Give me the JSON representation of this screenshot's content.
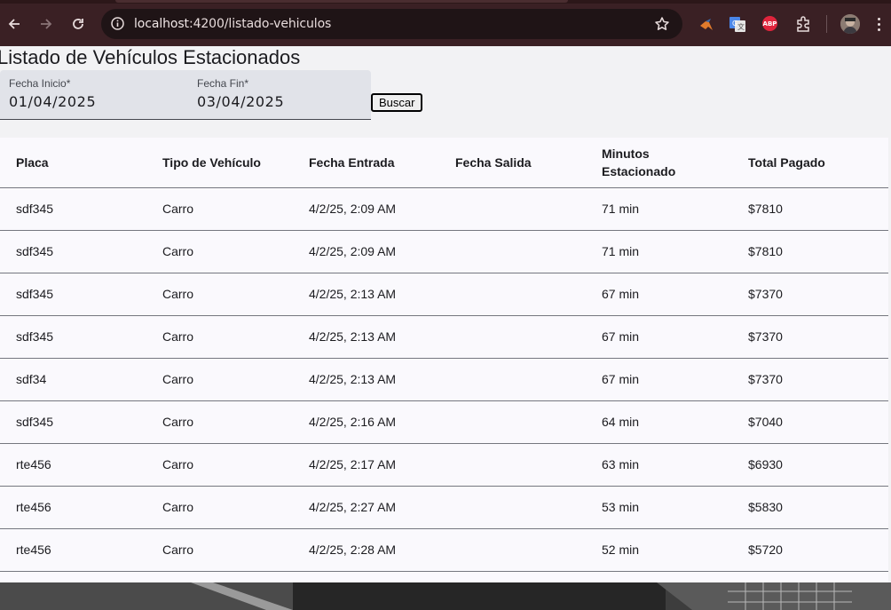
{
  "browser": {
    "url_host": "localhost",
    "url_rest": ":4200/listado-vehiculos",
    "ext_abp_label": "ABP"
  },
  "page": {
    "title": "Listado de Vehículos Estacionados",
    "fecha_inicio": {
      "label": "Fecha Inicio*",
      "value": "01/04/2025"
    },
    "fecha_fin": {
      "label": "Fecha Fin*",
      "value": "03/04/2025"
    },
    "buscar_label": "Buscar"
  },
  "table": {
    "headers": [
      "Placa",
      "Tipo de Vehículo",
      "Fecha Entrada",
      "Fecha Salida",
      "Minutos Estacionado",
      "Total Pagado"
    ],
    "rows": [
      [
        "sdf345",
        "Carro",
        "4/2/25, 2:09 AM",
        "",
        "71 min",
        "$7810"
      ],
      [
        "sdf345",
        "Carro",
        "4/2/25, 2:09 AM",
        "",
        "71 min",
        "$7810"
      ],
      [
        "sdf345",
        "Carro",
        "4/2/25, 2:13 AM",
        "",
        "67 min",
        "$7370"
      ],
      [
        "sdf345",
        "Carro",
        "4/2/25, 2:13 AM",
        "",
        "67 min",
        "$7370"
      ],
      [
        "sdf34",
        "Carro",
        "4/2/25, 2:13 AM",
        "",
        "67 min",
        "$7370"
      ],
      [
        "sdf345",
        "Carro",
        "4/2/25, 2:16 AM",
        "",
        "64 min",
        "$7040"
      ],
      [
        "rte456",
        "Carro",
        "4/2/25, 2:17 AM",
        "",
        "63 min",
        "$6930"
      ],
      [
        "rte456",
        "Carro",
        "4/2/25, 2:27 AM",
        "",
        "53 min",
        "$5830"
      ],
      [
        "rte456",
        "Carro",
        "4/2/25, 2:28 AM",
        "",
        "52 min",
        "$5720"
      ]
    ]
  }
}
